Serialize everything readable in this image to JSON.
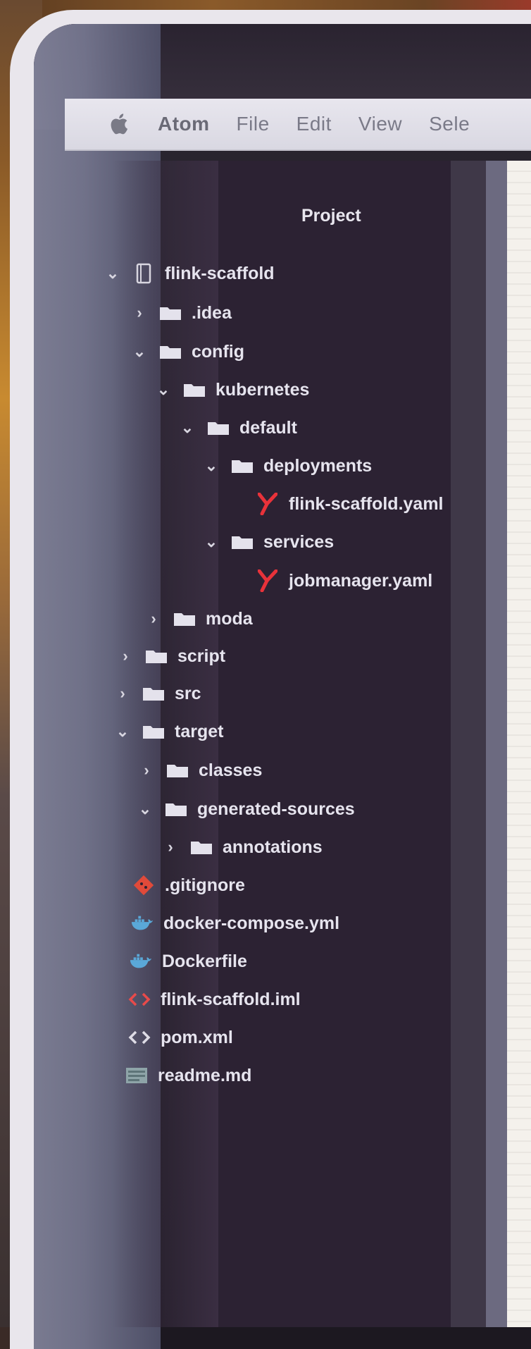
{
  "menubar": {
    "app": "Atom",
    "items": [
      "File",
      "Edit",
      "View",
      "Sele"
    ]
  },
  "panel": {
    "title": "Project"
  },
  "tree": [
    {
      "label": "flink-scaffold",
      "type": "repo",
      "expanded": true
    },
    {
      "label": ".idea",
      "type": "folder",
      "expanded": false
    },
    {
      "label": "config",
      "type": "folder",
      "expanded": true
    },
    {
      "label": "kubernetes",
      "type": "folder",
      "expanded": true
    },
    {
      "label": "default",
      "type": "folder",
      "expanded": true
    },
    {
      "label": "deployments",
      "type": "folder",
      "expanded": true
    },
    {
      "label": "flink-scaffold.yaml",
      "type": "yaml"
    },
    {
      "label": "services",
      "type": "folder",
      "expanded": true
    },
    {
      "label": "jobmanager.yaml",
      "type": "yaml"
    },
    {
      "label": "moda",
      "type": "folder",
      "expanded": false
    },
    {
      "label": "script",
      "type": "folder",
      "expanded": false
    },
    {
      "label": "src",
      "type": "folder",
      "expanded": false
    },
    {
      "label": "target",
      "type": "folder",
      "expanded": true
    },
    {
      "label": "classes",
      "type": "folder",
      "expanded": false
    },
    {
      "label": "generated-sources",
      "type": "folder",
      "expanded": true
    },
    {
      "label": "annotations",
      "type": "folder",
      "expanded": false
    },
    {
      "label": ".gitignore",
      "type": "git"
    },
    {
      "label": "docker-compose.yml",
      "type": "docker"
    },
    {
      "label": "Dockerfile",
      "type": "docker"
    },
    {
      "label": "flink-scaffold.iml",
      "type": "code-red"
    },
    {
      "label": "pom.xml",
      "type": "code"
    },
    {
      "label": "readme.md",
      "type": "markdown"
    }
  ],
  "colors": {
    "panel_bg": "#2c2233",
    "yaml_icon": "#e8323a",
    "git_icon": "#e04a3a",
    "docker_icon": "#5aa8d8",
    "iml_icon": "#e84a4a"
  }
}
